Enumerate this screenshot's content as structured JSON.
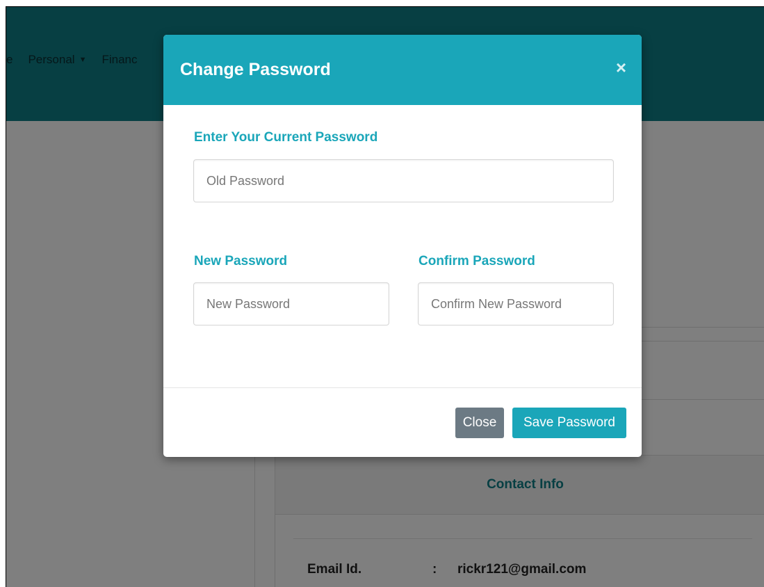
{
  "nav": {
    "items": [
      {
        "label": "e",
        "caret": false
      },
      {
        "label": "Personal",
        "caret": true
      },
      {
        "label": "Financ",
        "caret": false
      }
    ]
  },
  "contact": {
    "header": "Contact Info",
    "email_label": "Email Id.",
    "separator": ":",
    "email_value": "rickr121@gmail.com"
  },
  "modal": {
    "title": "Change Password",
    "close_icon": "×",
    "current_label": "Enter Your Current Password",
    "current_placeholder": "Old Password",
    "new_label": "New Password",
    "new_placeholder": "New Password",
    "confirm_label": "Confirm Password",
    "confirm_placeholder": "Confirm New Password",
    "close_button": "Close",
    "save_button": "Save Password"
  },
  "colors": {
    "accent": "#1aa6b9",
    "navbar": "#0e7e87",
    "close_button": "#6c7a84"
  }
}
